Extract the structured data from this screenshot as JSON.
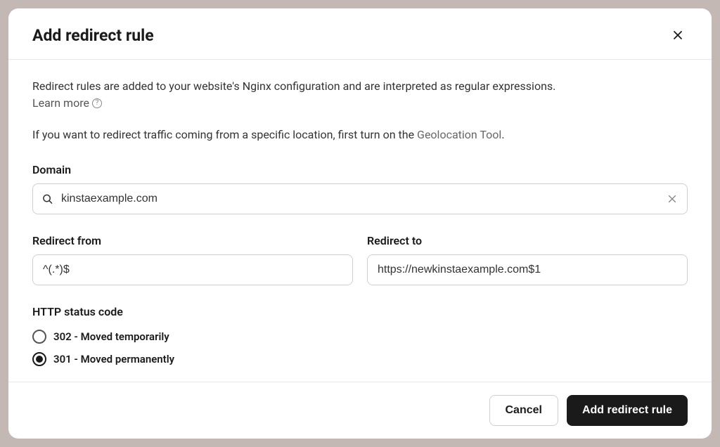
{
  "header": {
    "title": "Add redirect rule"
  },
  "body": {
    "description": "Redirect rules are added to your website's Nginx configuration and are interpreted as regular expressions.",
    "learn_more": "Learn more",
    "geo_text_prefix": "If you want to redirect traffic coming from a specific location, first turn on the ",
    "geo_link": "Geolocation Tool",
    "geo_text_suffix": "."
  },
  "form": {
    "domain": {
      "label": "Domain",
      "value": "kinstaexample.com"
    },
    "redirect_from": {
      "label": "Redirect from",
      "value": "^(.*)$"
    },
    "redirect_to": {
      "label": "Redirect to",
      "value": "https://newkinstaexample.com$1"
    },
    "status_code": {
      "label": "HTTP status code",
      "options": [
        {
          "label": "302 - Moved temporarily",
          "checked": false
        },
        {
          "label": "301 - Moved permanently",
          "checked": true
        }
      ]
    }
  },
  "footer": {
    "cancel": "Cancel",
    "submit": "Add redirect rule"
  }
}
